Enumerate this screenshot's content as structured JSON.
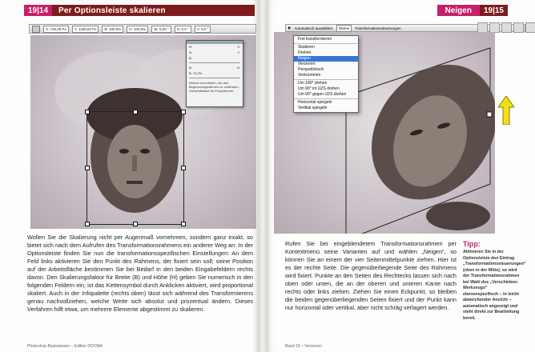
{
  "left_page": {
    "header_number": "19|14",
    "header_title": "Per Optionsleiste skalieren",
    "optionbar_fields": [
      "X: 725,29 Px",
      "Y: 1180,62 Px",
      "B: 100,0%",
      "H: 100,0%",
      "W: 0,00 °",
      "H: 0,0 °",
      "V: 0,0 °"
    ],
    "info_panel": {
      "rows": [
        [
          "R:",
          "X:"
        ],
        [
          "G:",
          "Y:"
        ],
        [
          "B:",
          ""
        ],
        [
          "B:",
          "H:"
        ]
      ],
      "percent_label": "B: 74,2%",
      "note": "Klicken und ziehen, um den Begrenzungsrahmen zu verändern. Umschalttaste für Proportionen."
    },
    "body": "Wollen Sie die Skalierung nicht per Augenmaß vornehmen, sondern ganz exakt, so bietet sich nach dem Aufrufen des Transformationsrahmens ein anderer Weg an: In der Optionsleiste finden Sie nun die transformationsspezifischen Einstellungen: An dem Feld links aktivieren Sie den Punkt des Rahmens, der fixiert sein soll; seine Position auf der Arbeitsfläche bestimmen Sie bei Bedarf in den beiden Eingabefeldern rechts davon. Den Skalierungsfaktor für Breite (B) und Höhe (H) geben Sie numerisch in den folgenden Feldern ein; ist das Kettensymbol durch Anklicken aktiviert, wird proportional skaliert. Auch in der Infopalette (rechts oben) lässt sich während des Transformierens genau nachvollziehen, welche Weite sich absolut und prozentual ändern. Dieses Verfahren hilft etwa, um mehrere Elemente abgestimmt zu skalieren.",
    "footer": "Photoshop-Basiswissen – Edition DOCMA"
  },
  "right_page": {
    "header_title": "Neigen",
    "header_number": "19|15",
    "optionbar_items": [
      "Automatisch auswählen:",
      "Ebene",
      "Transformationssteuerungen"
    ],
    "context_menu": [
      {
        "label": "Frei transformieren",
        "selected": false,
        "sep_after": true
      },
      {
        "label": "Skalieren",
        "selected": false,
        "sep_after": false
      },
      {
        "label": "Drehen",
        "selected": false,
        "sep_after": false
      },
      {
        "label": "Neigen",
        "selected": true,
        "sep_after": false
      },
      {
        "label": "Verzerren",
        "selected": false,
        "sep_after": false
      },
      {
        "label": "Perspektivisch",
        "selected": false,
        "sep_after": false
      },
      {
        "label": "Verkrümmen",
        "selected": false,
        "sep_after": true
      },
      {
        "label": "Um 180° drehen",
        "selected": false,
        "sep_after": false
      },
      {
        "label": "Um 90° im UZS drehen",
        "selected": false,
        "sep_after": false
      },
      {
        "label": "Um 90° gegen UZS drehen",
        "selected": false,
        "sep_after": true
      },
      {
        "label": "Horizontal spiegeln",
        "selected": false,
        "sep_after": false
      },
      {
        "label": "Vertikal spiegeln",
        "selected": false,
        "sep_after": false
      }
    ],
    "body": "Rufen Sie bei eingeblendetem Transformationsrahmen per Kontextmenü seine Varianten auf und wählen „Neigen“, so können Sie an einem der vier Seitenmittelpunkte ziehen. Hier ist es der rechte Seite. Die gegenüberliegende Seite des Rahmens wird fixiert. Punkte an den Seiten des Rechtecks lassen sich nach oben oder unten, die an der oberen und unteren Kante nach rechts oder links ziehen. Ziehen Sie einen Eckpunkt, so bleiben die beiden gegenüberliegenden Seiten fixiert und der Punkt kann nur horizontal oder vertikal, aber nicht schräg verlagert werden.",
    "tip_title": "Tipp:",
    "tip_text": "Aktivieren Sie in der Optionsleiste den Eintrag „Transformationssteuerungen“ (oben in der Mitte), so wird der Transformationsrahmen bei Wahl des „Verschieben-Werkzeugs“ ebenenspezifisch – in leicht abweichender Ansicht – automatisch angezeigt und steht direkt zur Bearbeitung bereit.",
    "footer": "Band 19 – Verzerren"
  },
  "colors": {
    "header_dark": "#7b1c1c",
    "header_accent": "#c81f6a",
    "tip_accent": "#c81f6a",
    "arrow_yellow": "#f2df1a"
  }
}
